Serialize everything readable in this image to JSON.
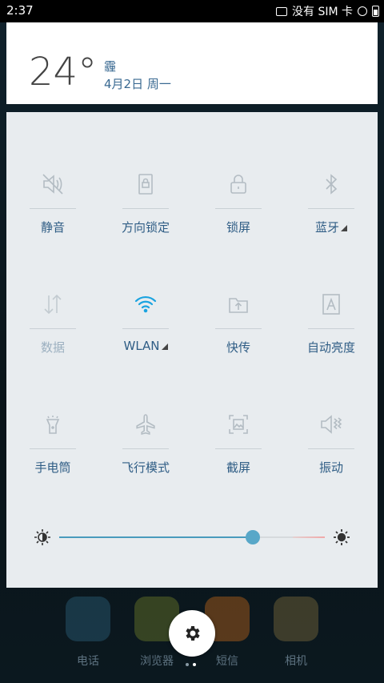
{
  "status_bar": {
    "time": "2:37",
    "sim_text": "没有 SIM 卡"
  },
  "weather": {
    "temperature": "24°",
    "condition": "霾",
    "date": "4月2日 周一"
  },
  "quick_settings": {
    "tiles": [
      {
        "label": "静音",
        "icon": "mute-icon",
        "active": false
      },
      {
        "label": "方向锁定",
        "icon": "orientation-lock-icon",
        "active": false
      },
      {
        "label": "锁屏",
        "icon": "lock-screen-icon",
        "active": false
      },
      {
        "label": "蓝牙",
        "icon": "bluetooth-icon",
        "active": false,
        "has_menu": true
      },
      {
        "label": "数据",
        "icon": "mobile-data-icon",
        "active": false,
        "disabled": true
      },
      {
        "label": "WLAN",
        "icon": "wifi-icon",
        "active": true,
        "has_menu": true
      },
      {
        "label": "快传",
        "icon": "quick-transfer-icon",
        "active": false
      },
      {
        "label": "自动亮度",
        "icon": "auto-brightness-icon",
        "active": false
      },
      {
        "label": "手电筒",
        "icon": "flashlight-icon",
        "active": false
      },
      {
        "label": "飞行模式",
        "icon": "airplane-icon",
        "active": false
      },
      {
        "label": "截屏",
        "icon": "screenshot-icon",
        "active": false
      },
      {
        "label": "振动",
        "icon": "vibrate-icon",
        "active": false
      }
    ],
    "brightness_level": 0.73
  },
  "dock": {
    "apps": [
      {
        "label": "电话",
        "color": "#2b5f7a"
      },
      {
        "label": "浏览器",
        "color": "#6b7a2a"
      },
      {
        "label": "短信",
        "color": "#b8641a"
      },
      {
        "label": "相机",
        "color": "#7b6a3b"
      }
    ]
  },
  "colors": {
    "accent": "#2f5d85",
    "wifi_active": "#1aa3e0",
    "icon_inactive": "#b3bcc3",
    "slider": "#58a7c8"
  }
}
